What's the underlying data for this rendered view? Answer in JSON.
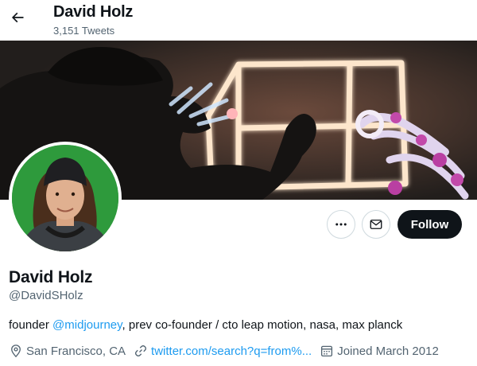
{
  "header": {
    "name": "David Holz",
    "tweet_count": "3,151 Tweets"
  },
  "profile": {
    "name": "David Holz",
    "handle": "@DavidSHolz",
    "bio_prefix": "founder ",
    "bio_mention": "@midjourney",
    "bio_suffix": ", prev co-founder / cto leap motion, nasa, max planck",
    "location": "San Francisco, CA",
    "website": "twitter.com/search?q=from%...",
    "joined": "Joined March 2012"
  },
  "actions": {
    "follow_label": "Follow"
  },
  "icons": {
    "back": "arrow-left-icon",
    "more": "more-dots-icon",
    "message": "mail-icon",
    "location": "location-pin-icon",
    "link": "link-icon",
    "calendar": "calendar-icon"
  },
  "colors": {
    "accent": "#1d9bf0",
    "text_primary": "#0f1419",
    "text_secondary": "#536471",
    "follow_bg": "#0f1419",
    "avatar_bg": "#2e9a3c"
  }
}
